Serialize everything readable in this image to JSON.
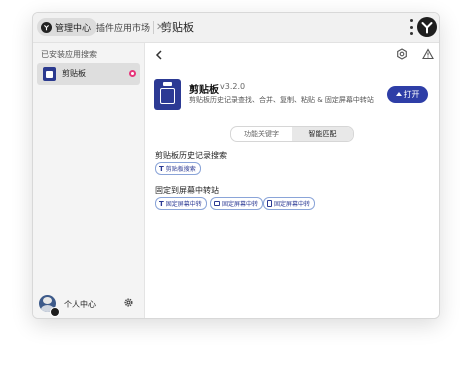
{
  "titlebar": {
    "tab_manage": "管理中心",
    "tab_market": "插件应用市场",
    "title": "剪贴板"
  },
  "sidebar": {
    "heading": "已安装应用搜索",
    "items": [
      {
        "label": "剪贴板",
        "status_color": "#e6347a"
      }
    ],
    "footer_label": "个人中心"
  },
  "plugin": {
    "name": "剪贴板",
    "version": "v3.2.0",
    "description": "剪贴板历史记录查找、合并、复制、粘贴 & 固定屏幕中转站",
    "open_label": "打开",
    "brand_color": "#2e3ea7"
  },
  "segmented": {
    "options": [
      "功能关键字",
      "智能匹配"
    ],
    "active": "智能匹配"
  },
  "sections": [
    {
      "title": "剪贴板历史记录搜索",
      "chips": [
        {
          "label": "剪贴板搜索",
          "icon": "text-icon"
        }
      ]
    },
    {
      "title": "固定到屏幕中转站",
      "chips": [
        {
          "label": "固定屏幕中转",
          "icon": "text-icon"
        },
        {
          "label": "固定屏幕中转",
          "icon": "image-icon"
        },
        {
          "label": "固定屏幕中转",
          "icon": "file-icon"
        }
      ]
    }
  ]
}
